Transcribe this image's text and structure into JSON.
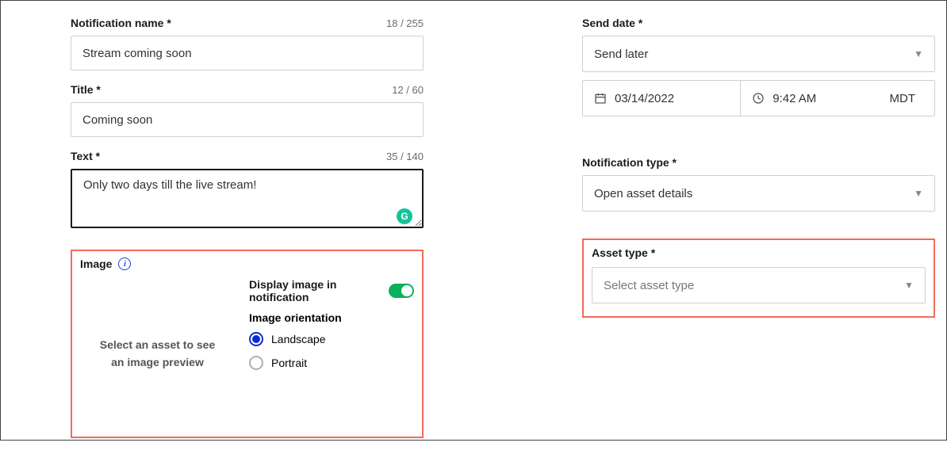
{
  "left": {
    "notification_name": {
      "label": "Notification name *",
      "value": "Stream coming soon",
      "counter": "18 / 255"
    },
    "title": {
      "label": "Title *",
      "value": "Coming soon",
      "counter": "12 / 60"
    },
    "text": {
      "label": "Text *",
      "value": "Only two days till the live stream!",
      "counter": "35 / 140"
    },
    "image": {
      "label": "Image",
      "preview_placeholder": "Select an asset to see an image preview",
      "display_toggle_label": "Display image in notification",
      "display_toggle_on": true,
      "orientation_label": "Image orientation",
      "landscape_label": "Landscape",
      "portrait_label": "Portrait",
      "orientation_selected": "landscape"
    }
  },
  "right": {
    "send_date": {
      "label": "Send date *",
      "mode": "Send later",
      "date": "03/14/2022",
      "time": "9:42 AM",
      "timezone": "MDT"
    },
    "notification_type": {
      "label": "Notification type *",
      "value": "Open asset details"
    },
    "asset_type": {
      "label": "Asset type *",
      "placeholder": "Select asset type"
    }
  }
}
